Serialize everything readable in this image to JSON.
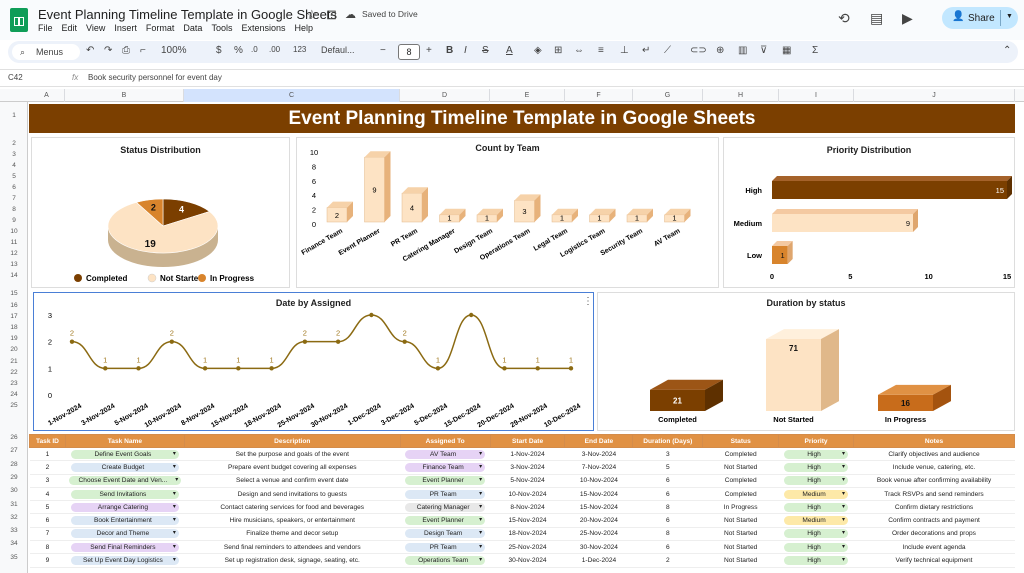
{
  "app": {
    "title": "Event Planning Timeline Template in Google Sheets",
    "saved": "Saved to Drive",
    "share_label": "Share",
    "menu": [
      "File",
      "Edit",
      "View",
      "Insert",
      "Format",
      "Data",
      "Tools",
      "Extensions",
      "Help"
    ]
  },
  "toolbar": {
    "menus_label": "Menus",
    "zoom": "100%",
    "currency": "$",
    "percent": "%",
    "dec1": ".0",
    "dec2": ".00",
    "numfmt": "123",
    "font": "Defaul...",
    "font_size": "8"
  },
  "formula": {
    "cell_ref": "C42",
    "fx": "fx",
    "content": "Book security personnel for event day"
  },
  "columns": [
    "A",
    "B",
    "C",
    "D",
    "E",
    "F",
    "G",
    "H",
    "I",
    "J"
  ],
  "rows": [
    "1",
    "2",
    "3",
    "4",
    "5",
    "6",
    "7",
    "8",
    "9",
    "10",
    "11",
    "12",
    "13",
    "14",
    "15",
    "16",
    "17",
    "18",
    "19",
    "20",
    "21",
    "22",
    "23",
    "24",
    "25",
    "26",
    "27",
    "28",
    "29",
    "30",
    "31",
    "32",
    "33",
    "34",
    "35"
  ],
  "banner": "Event Planning Timeline Template in Google Sheets",
  "colors": {
    "dark": "#7b3f00",
    "light": "#fde3c4",
    "mid": "#f1b986",
    "orange": "#d8842c",
    "header": "#e09144"
  },
  "chart_data": [
    {
      "type": "pie",
      "title": "Status Distribution",
      "categories": [
        "Completed",
        "Not Started",
        "In Progress"
      ],
      "values": [
        4,
        19,
        2
      ],
      "legend": "bottom"
    },
    {
      "type": "bar",
      "title": "Count by Team",
      "categories": [
        "Finance Team",
        "Event Planner",
        "PR Team",
        "Catering Manager",
        "Design Team",
        "Operations Team",
        "Legal Team",
        "Logistics Team",
        "Security Team",
        "AV Team"
      ],
      "values": [
        2,
        9,
        4,
        1,
        1,
        3,
        1,
        1,
        1,
        1
      ],
      "ylim": [
        0,
        10
      ],
      "yticks": [
        "10",
        "8",
        "6",
        "4",
        "2",
        "0"
      ]
    },
    {
      "type": "bar",
      "orientation": "horizontal",
      "title": "Priority Distribution",
      "categories": [
        "High",
        "Medium",
        "Low"
      ],
      "values": [
        15,
        9,
        1
      ],
      "xlim": [
        0,
        15
      ],
      "xticks": [
        "0",
        "5",
        "10",
        "15"
      ]
    },
    {
      "type": "line",
      "title": "Date by Assigned",
      "categories": [
        "1-Nov-2024",
        "3-Nov-2024",
        "5-Nov-2024",
        "10-Nov-2024",
        "8-Nov-2024",
        "15-Nov-2024",
        "18-Nov-2024",
        "25-Nov-2024",
        "30-Nov-2024",
        "1-Dec-2024",
        "3-Dec-2024",
        "5-Dec-2024",
        "15-Dec-2024",
        "20-Dec-2024",
        "29-Nov-2024",
        "10-Dec-2024"
      ],
      "values": [
        2,
        1,
        1,
        2,
        1,
        1,
        1,
        2,
        2,
        3,
        2,
        1,
        3,
        1,
        1,
        1
      ],
      "labels": [
        "2",
        "1",
        "1",
        "2",
        "1",
        "1",
        "1",
        "2",
        "2",
        "",
        "2",
        "1",
        "",
        "1",
        "1",
        "1"
      ],
      "ylim": [
        0,
        3
      ],
      "yticks": [
        "3",
        "2",
        "1",
        "0"
      ]
    },
    {
      "type": "bar",
      "title": "Duration by status",
      "categories": [
        "Completed",
        "Not Started",
        "In Progress"
      ],
      "values": [
        21,
        71,
        16
      ]
    }
  ],
  "table": {
    "headers": [
      "Task ID",
      "Task Name",
      "Description",
      "Assigned To",
      "Start Date",
      "End Date",
      "Duration (Days)",
      "Status",
      "Priority",
      "Notes"
    ],
    "rows": [
      [
        "1",
        "Define Event Goals",
        "Set the purpose and goals of the event",
        "AV Team",
        "1-Nov-2024",
        "3-Nov-2024",
        "3",
        "Completed",
        "High",
        "Clarify objectives and audience"
      ],
      [
        "2",
        "Create Budget",
        "Prepare event budget covering all expenses",
        "Finance Team",
        "3-Nov-2024",
        "7-Nov-2024",
        "5",
        "Not Started",
        "High",
        "Include venue, catering, etc."
      ],
      [
        "3",
        "Choose Event Date and Ven...",
        "Select a venue and confirm event date",
        "Event Planner",
        "5-Nov-2024",
        "10-Nov-2024",
        "6",
        "Completed",
        "High",
        "Book venue after confirming availability"
      ],
      [
        "4",
        "Send Invitations",
        "Design and send invitations to guests",
        "PR Team",
        "10-Nov-2024",
        "15-Nov-2024",
        "6",
        "Completed",
        "Medium",
        "Track RSVPs and send reminders"
      ],
      [
        "5",
        "Arrange Catering",
        "Contact catering services for food and beverages",
        "Catering Manager",
        "8-Nov-2024",
        "15-Nov-2024",
        "8",
        "In Progress",
        "High",
        "Confirm dietary restrictions"
      ],
      [
        "6",
        "Book Entertainment",
        "Hire musicians, speakers, or entertainment",
        "Event Planner",
        "15-Nov-2024",
        "20-Nov-2024",
        "6",
        "Not Started",
        "Medium",
        "Confirm contracts and payment"
      ],
      [
        "7",
        "Decor and Theme",
        "Finalize theme and decor setup",
        "Design Team",
        "18-Nov-2024",
        "25-Nov-2024",
        "8",
        "Not Started",
        "High",
        "Order decorations and props"
      ],
      [
        "8",
        "Send Final Reminders",
        "Send final reminders to attendees and vendors",
        "PR Team",
        "25-Nov-2024",
        "30-Nov-2024",
        "6",
        "Not Started",
        "High",
        "Include event agenda"
      ],
      [
        "9",
        "Set Up Event Day Logistics",
        "Set up registration desk, signage, seating, etc.",
        "Operations Team",
        "30-Nov-2024",
        "1-Dec-2024",
        "2",
        "Not Started",
        "High",
        "Verify technical equipment"
      ]
    ]
  }
}
